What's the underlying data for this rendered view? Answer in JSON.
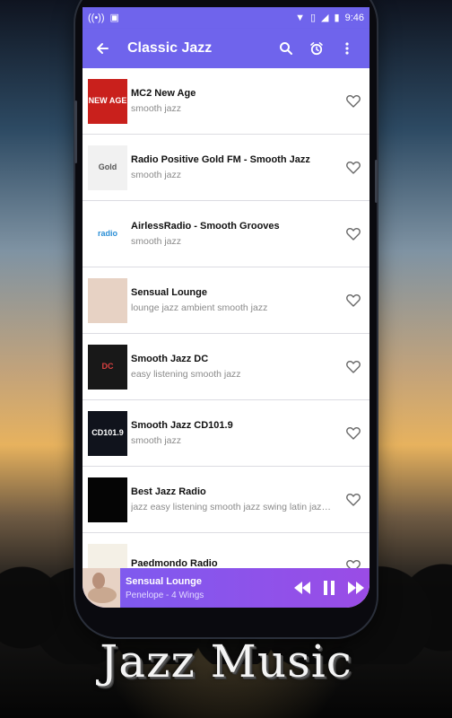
{
  "statusbar": {
    "time": "9:46"
  },
  "appbar": {
    "title": "Classic Jazz"
  },
  "stations": [
    {
      "name": "MC2 New Age",
      "tags": "smooth jazz",
      "logo_text": "NEW AGE",
      "logo_bg": "#c9201c",
      "logo_fg": "#ffffff"
    },
    {
      "name": "Radio Positive Gold FM - Smooth Jazz",
      "tags": "smooth jazz",
      "logo_text": "Gold",
      "logo_bg": "#f1f1f1",
      "logo_fg": "#555555"
    },
    {
      "name": "AirlessRadio - Smooth Grooves",
      "tags": "smooth jazz",
      "logo_text": "radio",
      "logo_bg": "#ffffff",
      "logo_fg": "#2b8fd6"
    },
    {
      "name": "Sensual Lounge",
      "tags": "lounge jazz ambient smooth jazz",
      "logo_text": "",
      "logo_bg": "#e7d2c4",
      "logo_fg": "#8a6a56"
    },
    {
      "name": "Smooth Jazz DC",
      "tags": "easy listening smooth jazz",
      "logo_text": "DC",
      "logo_bg": "#181818",
      "logo_fg": "#d84040"
    },
    {
      "name": "Smooth Jazz CD101.9",
      "tags": "smooth jazz",
      "logo_text": "CD101.9",
      "logo_bg": "#10131c",
      "logo_fg": "#ffffff"
    },
    {
      "name": "Best Jazz Radio",
      "tags": "jazz easy listening smooth jazz swing latin jazz bi…",
      "logo_text": "",
      "logo_bg": "#050505",
      "logo_fg": "#c9a184"
    },
    {
      "name": "Paedmondo Radio",
      "tags": "",
      "logo_text": "",
      "logo_bg": "#f4f0e6",
      "logo_fg": "#a04040"
    }
  ],
  "player": {
    "title": "Sensual Lounge",
    "artist": "Penelope - 4 Wings"
  },
  "caption": "Jazz Music",
  "colors": {
    "accent": "#6f64ec",
    "player_left": "#7b5cf0",
    "player_right": "#9a4ce6"
  }
}
